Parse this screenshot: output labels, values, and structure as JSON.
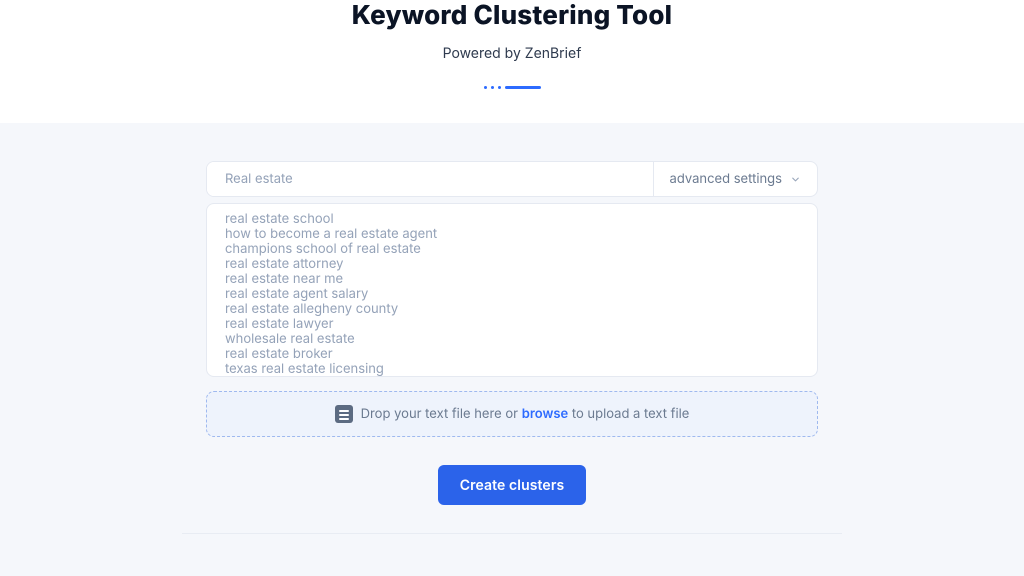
{
  "header": {
    "title": "Keyword Clustering Tool",
    "subtitle": "Powered by ZenBrief"
  },
  "search": {
    "value": "Real estate",
    "advanced_label": "advanced settings"
  },
  "keywords": [
    "real estate school",
    "how to become a real estate agent",
    "champions school of real estate",
    "real estate attorney",
    "real estate near me",
    "real estate agent salary",
    "real estate allegheny county",
    "real estate lawyer",
    "wholesale real estate",
    "real estate broker",
    "texas real estate licensing"
  ],
  "dropzone": {
    "pre": "Drop your text file here or ",
    "link": "browse",
    "post": " to upload a text file"
  },
  "cta": {
    "label": "Create clusters"
  }
}
